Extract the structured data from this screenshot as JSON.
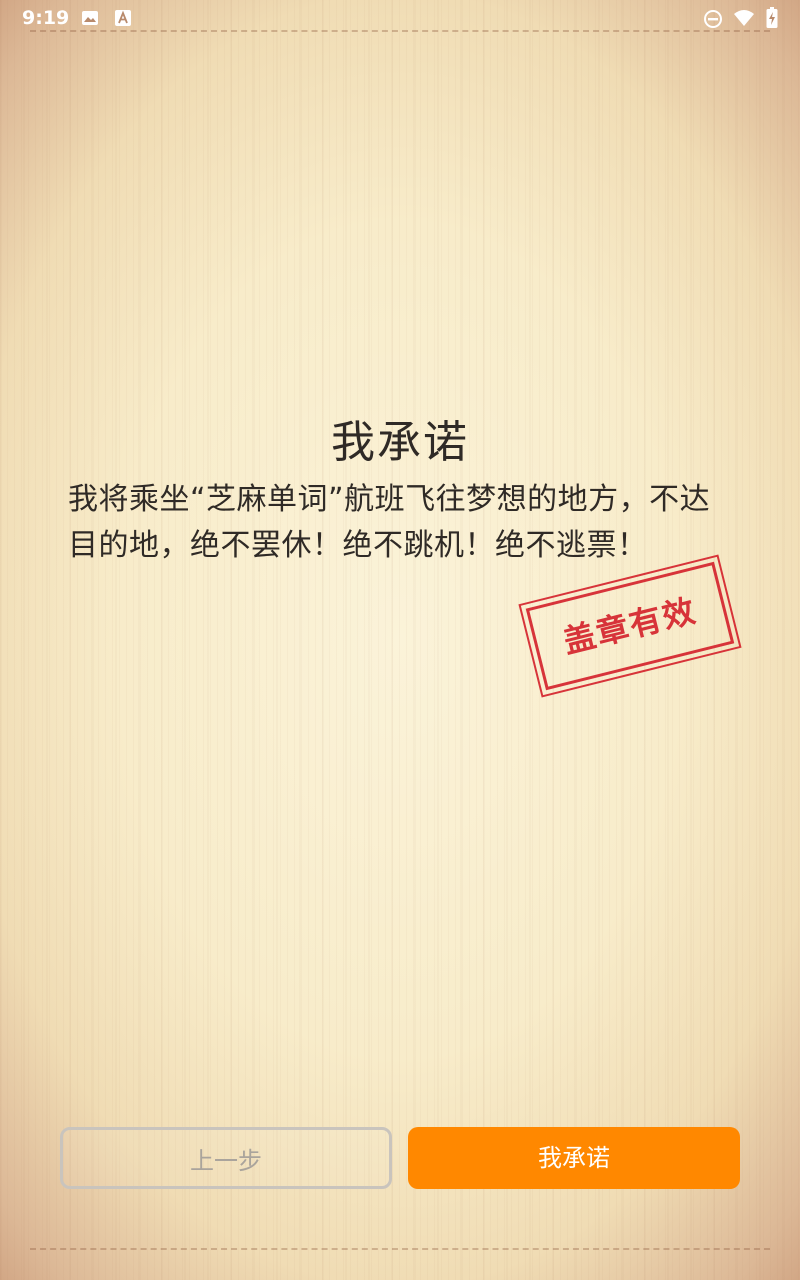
{
  "status_bar": {
    "time": "9:19",
    "icons": [
      "image-icon",
      "font-a-icon",
      "do-not-disturb-icon",
      "wifi-icon",
      "battery-charging-icon"
    ]
  },
  "pledge": {
    "title": "我承诺",
    "text": "我将乘坐“芝麻单词”航班飞往梦想的地方，不达目的地，绝不罢休！绝不跳机！绝不逃票！",
    "stamp_text": "盖章有效"
  },
  "buttons": {
    "prev_label": "上一步",
    "confirm_label": "我承诺"
  },
  "colors": {
    "accent": "#ff8800",
    "stamp": "#d4202a",
    "text": "#2f2a26"
  }
}
